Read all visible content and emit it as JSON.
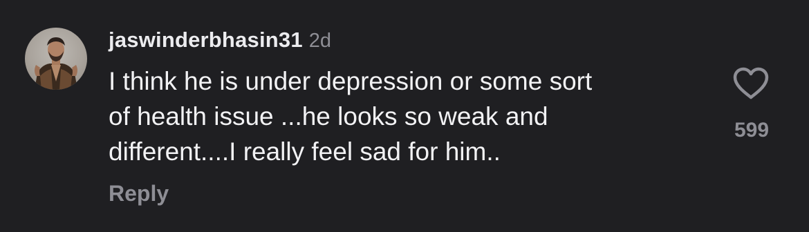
{
  "comment": {
    "username": "jaswinderbhasin31",
    "timestamp": "2d",
    "text": "I think he is under depression or some sort\nof health issue ...he looks so weak and\ndifferent....I really feel sad for him..",
    "reply_label": "Reply",
    "like_count": "599",
    "like_icon": "heart-outline-icon"
  },
  "colors": {
    "background": "#1f1f22",
    "primary_text": "#f2f2f4",
    "secondary_text": "#8e8e95"
  }
}
